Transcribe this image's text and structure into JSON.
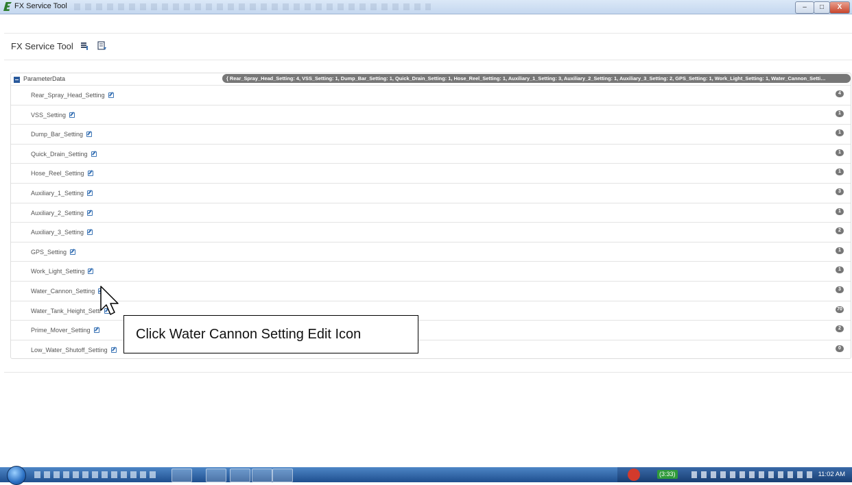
{
  "window": {
    "title": "FX Service Tool",
    "buttons": {
      "minimize": "–",
      "maximize": "□",
      "close": "X"
    }
  },
  "header": {
    "title": "FX Service Tool",
    "icons": [
      "export-icon",
      "report-icon"
    ]
  },
  "parameter_data": {
    "label": "ParameterData",
    "summary": "{ Rear_Spray_Head_Setting: 4, VSS_Setting: 1, Dump_Bar_Setting: 1, Quick_Drain_Setting: 1, Hose_Reel_Setting: 1, Auxiliary_1_Setting: 3, Auxiliary_2_Setting: 1, Auxiliary_3_Setting: 2, GPS_Setting: 1, Work_Light_Setting: 1, Water_Cannon_Setti…",
    "rows": [
      {
        "label": "Rear_Spray_Head_Setting",
        "value": "4"
      },
      {
        "label": "VSS_Setting",
        "value": "1"
      },
      {
        "label": "Dump_Bar_Setting",
        "value": "1"
      },
      {
        "label": "Quick_Drain_Setting",
        "value": "1"
      },
      {
        "label": "Hose_Reel_Setting",
        "value": "1"
      },
      {
        "label": "Auxiliary_1_Setting",
        "value": "3"
      },
      {
        "label": "Auxiliary_2_Setting",
        "value": "1"
      },
      {
        "label": "Auxiliary_3_Setting",
        "value": "2"
      },
      {
        "label": "GPS_Setting",
        "value": "1"
      },
      {
        "label": "Work_Light_Setting",
        "value": "1"
      },
      {
        "label": "Water_Cannon_Setting",
        "value": "3"
      },
      {
        "label": "Water_Tank_Height_Setti",
        "value": "70"
      },
      {
        "label": "Prime_Mover_Setting",
        "value": "2"
      },
      {
        "label": "Low_Water_Shutoff_Setting",
        "value": "0"
      }
    ]
  },
  "callout": {
    "text": "Click Water Cannon Setting Edit Icon"
  },
  "taskbar": {
    "tray_badge": "(3:33)",
    "clock": "11:02 AM"
  }
}
